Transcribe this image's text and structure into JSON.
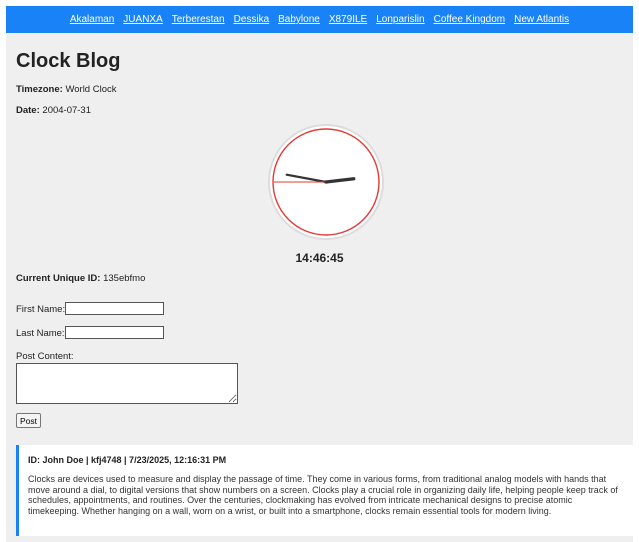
{
  "nav": {
    "links": [
      "Akalaman",
      "JUANXA",
      "Terberestan",
      "Dessika",
      "Babylone",
      "X879ILE",
      "Lonparislin",
      "Coffee Kingdom",
      "New Atlantis"
    ]
  },
  "header": {
    "title": "Clock Blog",
    "timezone_label": "Timezone:",
    "timezone_value": "World Clock",
    "date_label": "Date:",
    "date_value": "2004-07-31"
  },
  "clock": {
    "time": "14:46:45",
    "hours": 14,
    "minutes": 46,
    "seconds": 45
  },
  "session": {
    "unique_id_label": "Current Unique ID:",
    "unique_id_value": "135ebfmo"
  },
  "form": {
    "first_name_label": "First Name:",
    "first_name_value": "",
    "last_name_label": "Last Name:",
    "last_name_value": "",
    "content_label": "Post Content:",
    "content_value": "",
    "post_button": "Post"
  },
  "posts": [
    {
      "header": "ID: John Doe | kfj4748 | 7/23/2025, 12:16:31 PM",
      "body": "Clocks are devices used to measure and display the passage of time. They come in various forms, from traditional analog models with hands that move around a dial, to digital versions that show numbers on a screen. Clocks play a crucial role in organizing daily life, helping people keep track of schedules, appointments, and routines. Over the centuries, clockmaking has evolved from intricate mechanical designs to precise atomic timekeeping. Whether hanging on a wall, worn on a wrist, or built into a smartphone, clocks remain essential tools for modern living."
    }
  ],
  "colors": {
    "nav_bg": "#1a82f7",
    "page_bg": "#efefef",
    "clock_rim": "#e53935",
    "second_hand": "#e53935",
    "hands": "#333333",
    "post_accent": "#1a82f7"
  }
}
